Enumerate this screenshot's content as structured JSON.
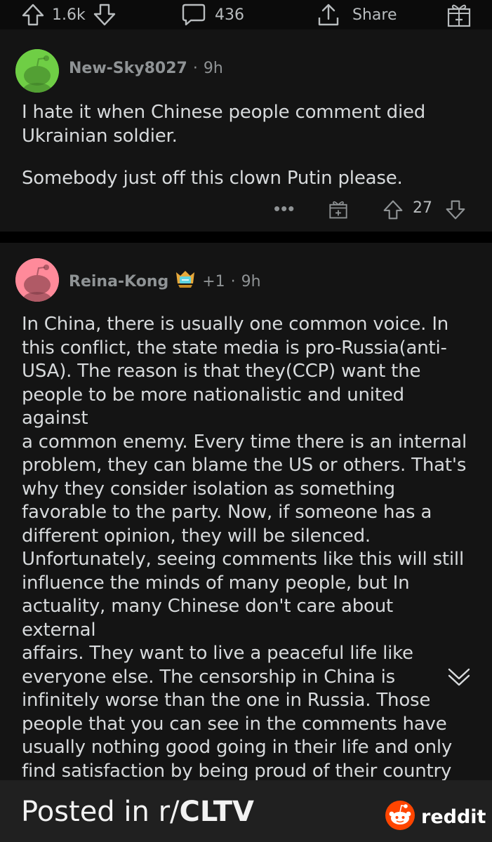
{
  "post_actions": {
    "vote_count": "1.6k",
    "comment_count": "436",
    "share_label": "Share",
    "icons": [
      "upvote-icon",
      "downvote-icon",
      "comment-bubble-icon",
      "share-icon",
      "award-icon"
    ]
  },
  "comments": [
    {
      "username": "New-Sky8027",
      "separator": "·",
      "time": "9h",
      "avatar_color": "#6fce45",
      "paragraphs": [
        "I hate it when Chinese people comment died\nUkrainian soldier.",
        "Somebody just off this clown Putin please."
      ],
      "more": "•••",
      "score": "27"
    },
    {
      "username": "Reina-Kong",
      "flair_extra": "+1",
      "separator": "·",
      "time": "9h",
      "avatar_color": "#ff8a9a",
      "body": "In China, there is usually one common voice. In\nthis conflict, the state media is pro-Russia(anti-\nUSA). The reason is that they(CCP) want the\npeople to be more nationalistic and united against\na common enemy. Every time there is an internal\nproblem, they can blame the US or others. That's\nwhy they consider isolation as something\nfavorable to the party. Now, if someone has a\ndifferent opinion, they will be silenced.\nUnfortunately, seeing comments like this will still\ninfluence the minds of many people, but In\nactuality, many Chinese don't care about external\naffairs. They want to live a peaceful life like\neveryone else. The censorship in China is\ninfinitely worse than the one in Russia. Those\npeople that you can see in the comments have\nusually nothing good going in their life and only\nfind satisfaction by being proud of their country\nor attacking others. Weibo is a horrible place to\nspend your time, especially if you look for political"
    }
  ],
  "footer": {
    "prefix": "Posted in r/",
    "subreddit": "CLTV",
    "brand": "reddit",
    "brand_color": "#ff4500"
  }
}
